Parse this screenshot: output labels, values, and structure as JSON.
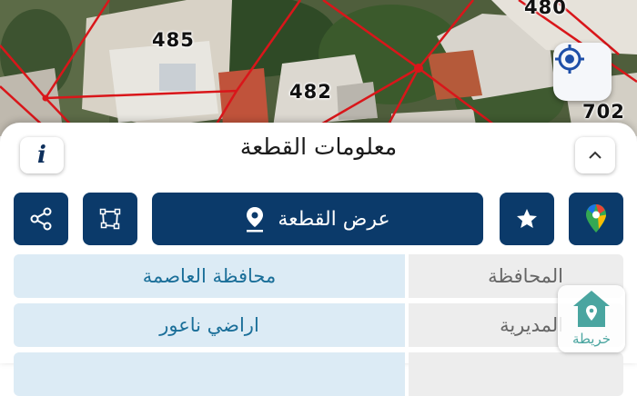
{
  "map": {
    "parcel_labels": [
      "485",
      "482",
      "480",
      "702"
    ],
    "locate_icon": "crosshair-icon",
    "boundary_color": "#d9161a"
  },
  "panel": {
    "title": "معلومات القطعة",
    "info_label": "i",
    "collapse_icon": "chevron-up-icon"
  },
  "actions": {
    "share_icon": "share-icon",
    "polygon_icon": "polygon-icon",
    "show_parcel_label": "عرض القطعة",
    "show_parcel_icon": "map-pin-icon",
    "favorite_icon": "star-icon",
    "google_maps_icon": "google-maps-icon"
  },
  "details": [
    {
      "key": "المحافظة",
      "value": "محافظة العاصمة"
    },
    {
      "key": "المديرية",
      "value": "اراضي ناعور"
    }
  ],
  "bottom_tab": {
    "label": "خريطة",
    "icon": "map-house-icon"
  },
  "colors": {
    "primary": "#0b3a6a",
    "value_bg": "#dcebf5",
    "value_text": "#1b6f99",
    "key_bg": "#ededed",
    "accent": "#4aa5a0"
  }
}
